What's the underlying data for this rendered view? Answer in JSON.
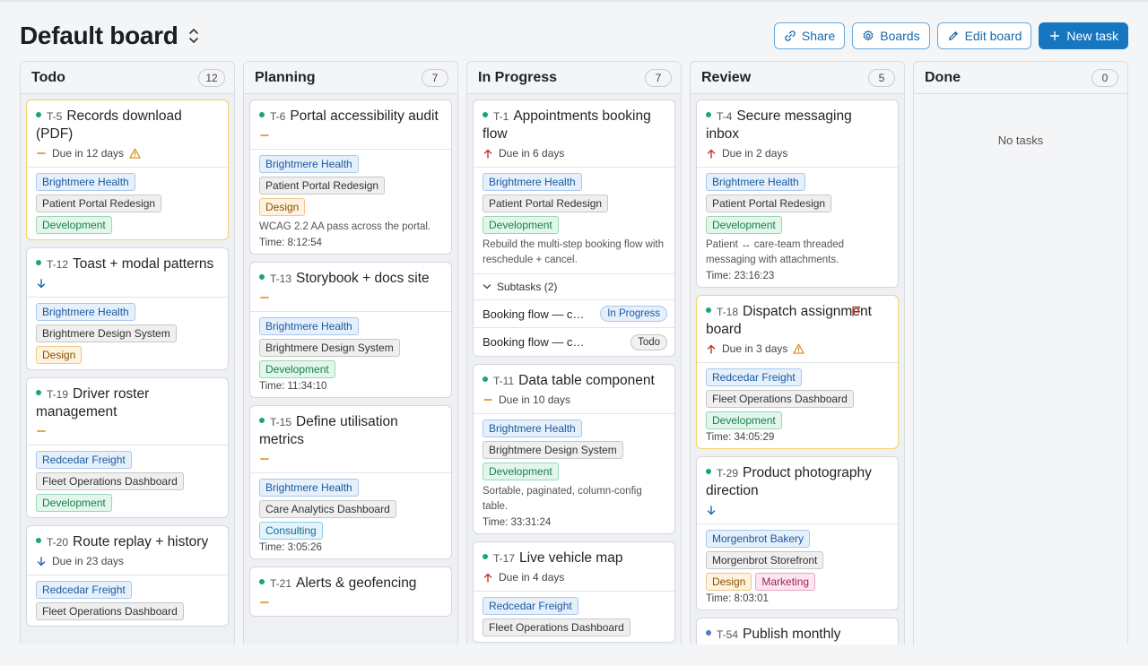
{
  "header": {
    "title": "Default board",
    "actions": {
      "share": "Share",
      "boards": "Boards",
      "edit": "Edit board",
      "new_task": "New task"
    }
  },
  "columns": [
    {
      "title": "Todo",
      "count": "12",
      "cards": [
        {
          "id": "T-5",
          "title": "Records download (PDF)",
          "due": "Due in 12 days",
          "warn": true,
          "tags": [
            "Brightmere Health",
            "Patient Portal Redesign",
            "Development"
          ]
        },
        {
          "id": "T-12",
          "title": "Toast + modal patterns",
          "tags": [
            "Brightmere Health",
            "Brightmere Design System",
            "Design"
          ]
        },
        {
          "id": "T-19",
          "title": "Driver roster management",
          "tags": [
            "Redcedar Freight",
            "Fleet Operations Dashboard",
            "Development"
          ]
        },
        {
          "id": "T-20",
          "title": "Route replay + history",
          "due": "Due in 23 days",
          "tags": [
            "Redcedar Freight",
            "Fleet Operations Dashboard"
          ]
        }
      ]
    },
    {
      "title": "Planning",
      "count": "7",
      "cards": [
        {
          "id": "T-6",
          "title": "Portal accessibility audit",
          "tags": [
            "Brightmere Health",
            "Patient Portal Redesign",
            "Design"
          ],
          "desc": "WCAG 2.2 AA pass across the portal.",
          "time": "Time: 8:12:54"
        },
        {
          "id": "T-13",
          "title": "Storybook + docs site",
          "tags": [
            "Brightmere Health",
            "Brightmere Design System",
            "Development"
          ],
          "time": "Time: 11:34:10"
        },
        {
          "id": "T-15",
          "title": "Define utilisation metrics",
          "tags": [
            "Brightmere Health",
            "Care Analytics Dashboard",
            "Consulting"
          ],
          "time": "Time: 3:05:26"
        },
        {
          "id": "T-21",
          "title": "Alerts & geofencing"
        }
      ]
    },
    {
      "title": "In Progress",
      "count": "7",
      "cards": [
        {
          "id": "T-1",
          "title": "Appointments booking flow",
          "due": "Due in 6 days",
          "tags": [
            "Brightmere Health",
            "Patient Portal Redesign",
            "Development"
          ],
          "desc": "Rebuild the multi-step booking flow with reschedule + cancel.",
          "subtasks_label": "Subtasks (2)",
          "subtasks": [
            {
              "name": "Booking flow — calendar",
              "status": "In Progress"
            },
            {
              "name": "Booking flow — confirmation",
              "status": "Todo"
            }
          ]
        },
        {
          "id": "T-11",
          "title": "Data table component",
          "due": "Due in 10 days",
          "tags": [
            "Brightmere Health",
            "Brightmere Design System",
            "Development"
          ],
          "desc": "Sortable, paginated, column-config table.",
          "time": "Time: 33:31:24"
        },
        {
          "id": "T-17",
          "title": "Live vehicle map",
          "due": "Due in 4 days",
          "tags": [
            "Redcedar Freight",
            "Fleet Operations Dashboard"
          ]
        }
      ]
    },
    {
      "title": "Review",
      "count": "5",
      "cards": [
        {
          "id": "T-4",
          "title": "Secure messaging inbox",
          "due": "Due in 2 days",
          "tags": [
            "Brightmere Health",
            "Patient Portal Redesign",
            "Development"
          ],
          "desc": "Patient ↔ care-team threaded messaging with attachments.",
          "time": "Time: 23:16:23"
        },
        {
          "id": "T-18",
          "title": "Dispatch assignment board",
          "due": "Due in 3 days",
          "warn": true,
          "tags": [
            "Redcedar Freight",
            "Fleet Operations Dashboard",
            "Development"
          ],
          "time": "Time: 34:05:29"
        },
        {
          "id": "T-29",
          "title": "Product photography direction",
          "tags": [
            "Morgenbrot Bakery",
            "Morgenbrot Storefront",
            "Design",
            "Marketing"
          ],
          "time": "Time: 8:03:01"
        },
        {
          "id": "T-54",
          "title": "Publish monthly"
        }
      ]
    },
    {
      "title": "Done",
      "count": "0",
      "empty": "No tasks",
      "cards": []
    }
  ],
  "colors": {
    "accent": "#1676c0",
    "status_dot": "#1aa670",
    "priority_high": "#c0392b",
    "priority_medium": "#d98a1a",
    "priority_low": "#2563b0",
    "warning": "#d98a1a"
  },
  "icons": [
    "chevron-up-down-icon",
    "link-icon",
    "gear-icon",
    "pencil-icon",
    "plus-icon",
    "arrow-up-icon",
    "arrow-down-icon",
    "dash-icon",
    "warning-icon",
    "flag-icon",
    "chevron-down-icon"
  ]
}
